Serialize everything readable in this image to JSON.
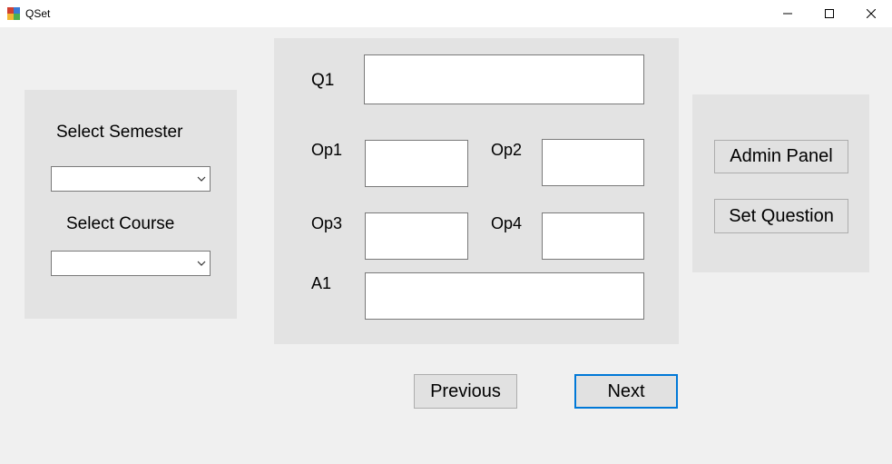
{
  "window": {
    "title": "QSet",
    "controls": {
      "minimize": "minimize",
      "maximize": "maximize",
      "close": "close"
    }
  },
  "left_panel": {
    "semester_label": "Select  Semester",
    "semester_value": "",
    "course_label": "Select Course",
    "course_value": ""
  },
  "question_panel": {
    "q1_label": "Q1",
    "q1_value": "",
    "op1_label": "Op1",
    "op1_value": "",
    "op2_label": "Op2",
    "op2_value": "",
    "op3_label": "Op3",
    "op3_value": "",
    "op4_label": "Op4",
    "op4_value": "",
    "a1_label": "A1",
    "a1_value": ""
  },
  "right_panel": {
    "admin_panel_label": "Admin Panel",
    "set_question_label": "Set Question"
  },
  "navigation": {
    "previous_label": "Previous",
    "next_label": "Next"
  },
  "colors": {
    "background": "#f0f0f0",
    "panel": "#e3e3e3",
    "focus_border": "#0078d7"
  },
  "icons": {
    "app": "app-icon",
    "dropdown": "chevron-down-icon"
  }
}
